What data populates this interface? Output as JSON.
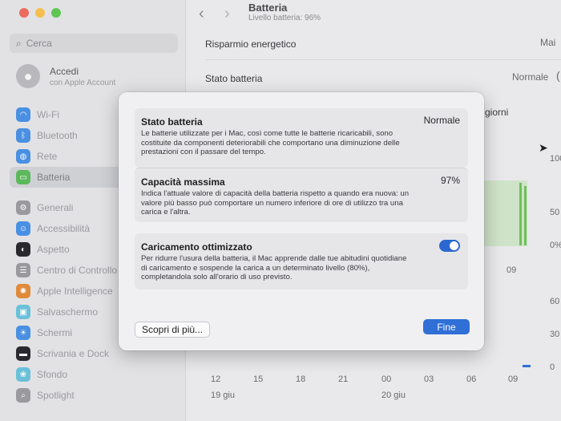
{
  "window": {
    "traffic": {
      "close": "#ec6a5e",
      "minimize": "#f4bf4f",
      "zoom": "#61c554"
    }
  },
  "sidebar": {
    "search_placeholder": "Cerca",
    "account": {
      "title": "Accedi",
      "subtitle": "con Apple Account"
    },
    "items": [
      {
        "label": "Wi-Fi",
        "color": "#4a90e2"
      },
      {
        "label": "Bluetooth",
        "color": "#4a90e2"
      },
      {
        "label": "Rete",
        "color": "#4a90e2"
      },
      {
        "label": "Batteria",
        "color": "#5cb85c",
        "active": true
      },
      {
        "label": "Generali",
        "color": "#9a9a9e"
      },
      {
        "label": "Accessibilità",
        "color": "#4a90e2"
      },
      {
        "label": "Aspetto",
        "color": "#2a2a2e"
      },
      {
        "label": "Centro di Controllo",
        "color": "#9a9a9e"
      },
      {
        "label": "Apple Intelligence",
        "color": "#e08a3c"
      },
      {
        "label": "Salvaschermo",
        "color": "#6ac0d8"
      },
      {
        "label": "Schermi",
        "color": "#4a90e2"
      },
      {
        "label": "Scrivania e Dock",
        "color": "#2a2a2e"
      },
      {
        "label": "Sfondo",
        "color": "#6ac0d8"
      },
      {
        "label": "Spotlight",
        "color": "#9a9a9e"
      }
    ]
  },
  "header": {
    "title": "Batteria",
    "subtitle": "Livello batteria: 96%"
  },
  "main": {
    "rows": [
      {
        "label": "Risparmio energetico",
        "value": "Mai"
      },
      {
        "label": "Stato batteria",
        "value": "Normale"
      }
    ],
    "partial_label": "giorni",
    "y_ticks_top": [
      "100",
      "50",
      "0%"
    ],
    "y_ticks_bottom": [
      "60",
      "30",
      "0"
    ],
    "x_mid": "09",
    "x_ticks": [
      "12",
      "15",
      "18",
      "21",
      "00",
      "03",
      "06",
      "09"
    ],
    "dates": [
      "19 giu",
      "20 giu"
    ]
  },
  "modal": {
    "cards": [
      {
        "title": "Stato batteria",
        "value": "Normale",
        "description": "Le batterie utilizzate per i Mac, così come tutte le batterie ricaricabili, sono costituite da componenti deteriorabili che comportano una diminuzione delle prestazioni con il passare del tempo."
      },
      {
        "title": "Capacità massima",
        "value": "97%",
        "description": "Indica l'attuale valore di capacità della batteria rispetto a quando era nuova: un valore più basso può comportare un numero inferiore di ore di utilizzo tra una carica e l'altra."
      },
      {
        "title": "Caricamento ottimizzato",
        "toggle_on": true,
        "description": "Per ridurre l'usura della batteria, il Mac apprende dalle tue abitudini quotidiane di caricamento e sospende la carica a un determinato livello (80%), completandola solo all'orario di uso previsto."
      }
    ],
    "learn_more": "Scopri di più...",
    "done": "Fine"
  }
}
